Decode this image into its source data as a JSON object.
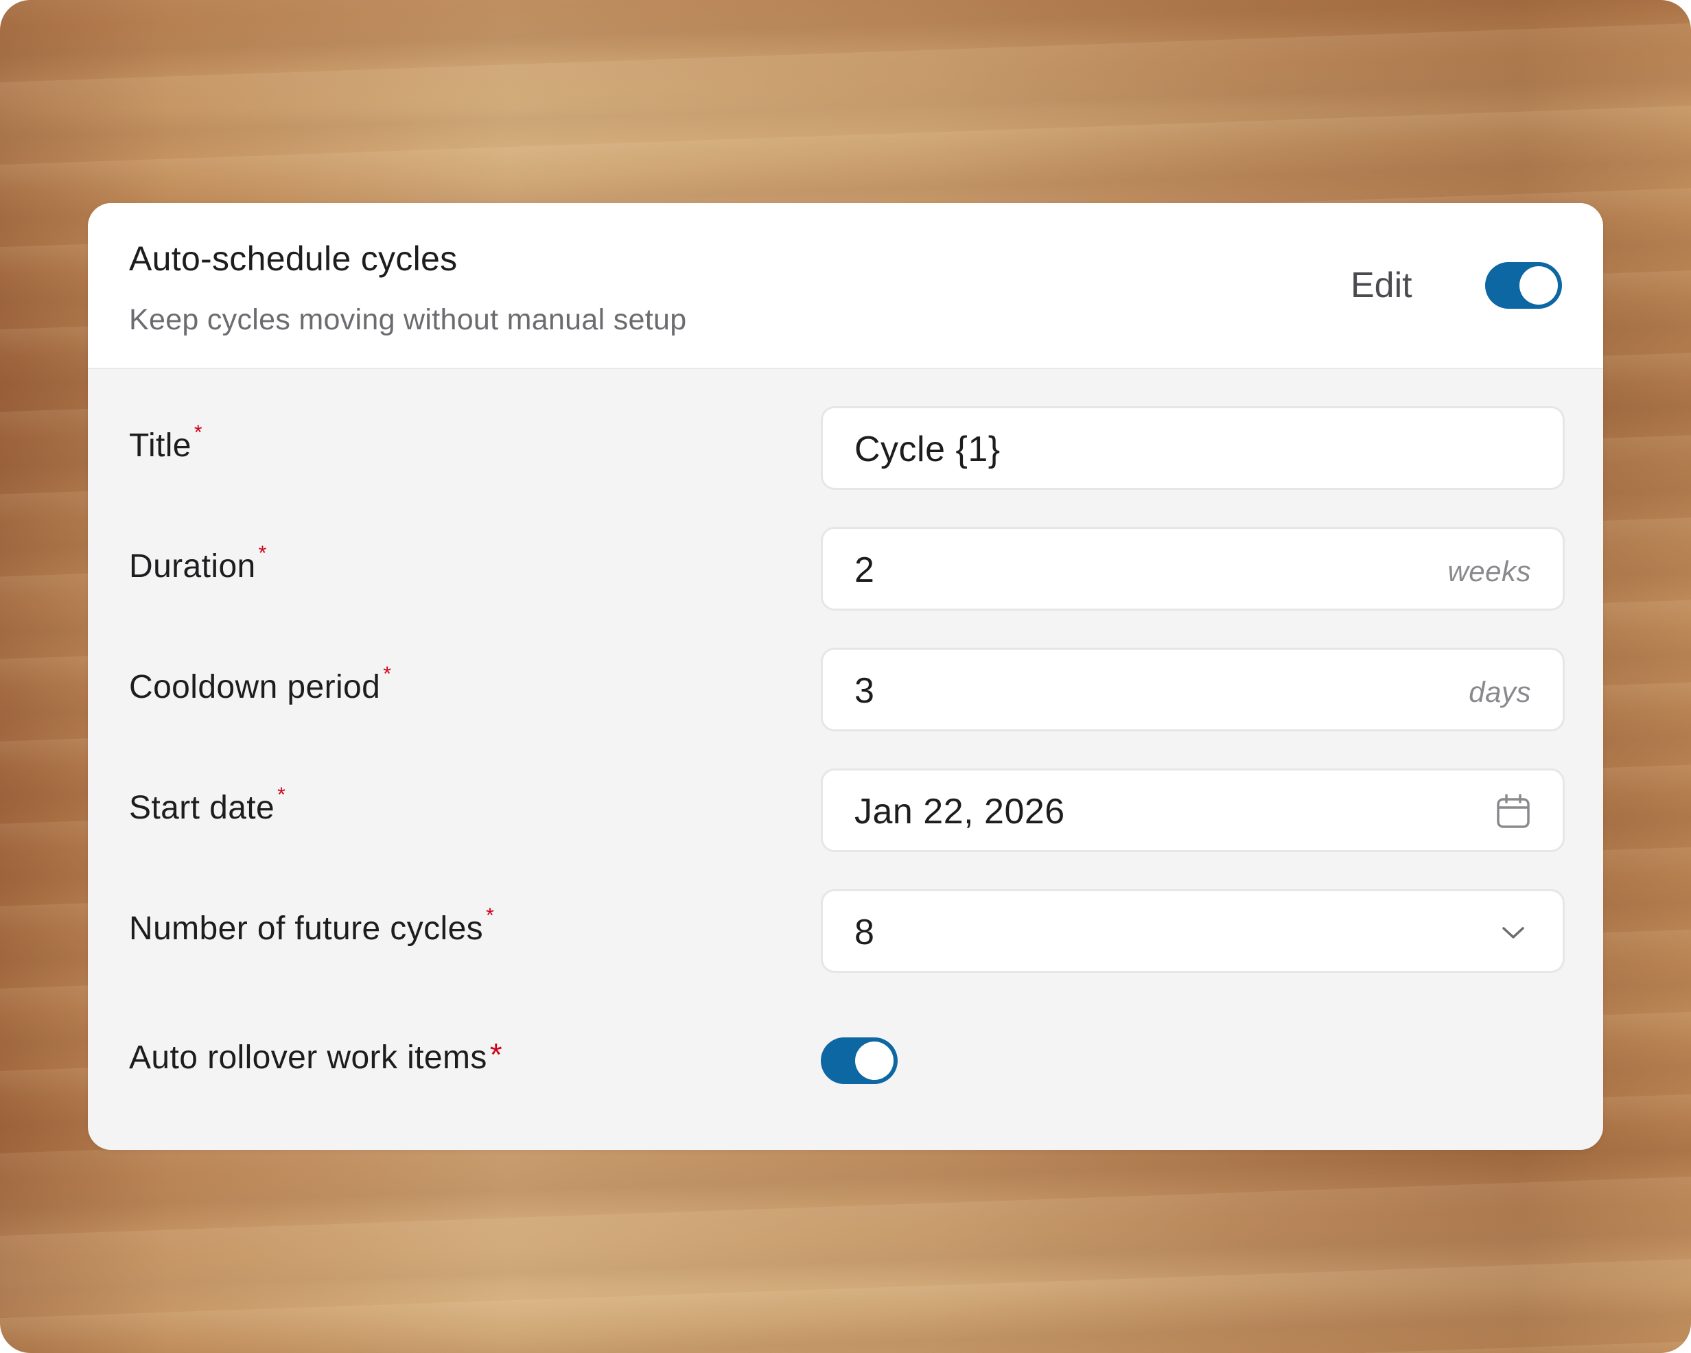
{
  "header": {
    "title": "Auto-schedule cycles",
    "subtitle": "Keep cycles moving without manual setup",
    "edit_label": "Edit",
    "edit_toggle_on": true
  },
  "fields": {
    "title": {
      "label": "Title",
      "required": "*",
      "value": "Cycle {1}"
    },
    "duration": {
      "label": "Duration",
      "required": "*",
      "value": "2",
      "unit": "weeks"
    },
    "cooldown": {
      "label": "Cooldown period",
      "required": "*",
      "value": "3",
      "unit": "days"
    },
    "start_date": {
      "label": "Start date",
      "required": "*",
      "value": "Jan 22, 2026",
      "icon": "calendar-icon"
    },
    "future_cycles": {
      "label": "Number of future cycles",
      "required": "*",
      "value": "8",
      "icon": "chevron-down-icon"
    },
    "auto_rollover": {
      "label": "Auto rollover work items",
      "required": "*",
      "toggle_on": true
    }
  },
  "colors": {
    "accent": "#0d67a3",
    "required": "#d0021b",
    "card_body": "#f4f4f4"
  }
}
